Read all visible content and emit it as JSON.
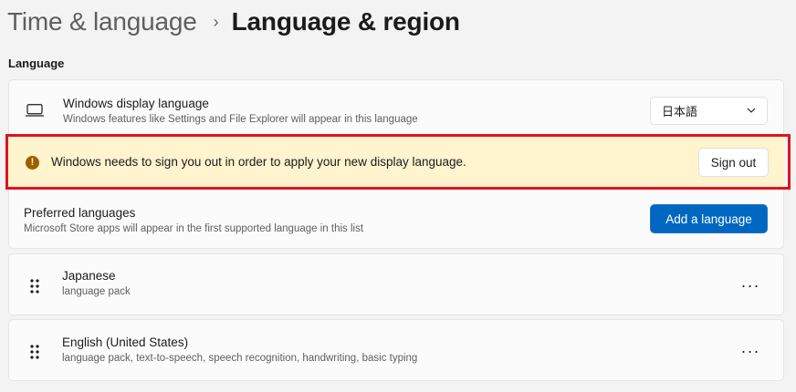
{
  "breadcrumb": {
    "parent": "Time & language",
    "separator": "›",
    "current": "Language & region"
  },
  "language_section": {
    "label": "Language",
    "display_language": {
      "icon": "monitor-icon",
      "title": "Windows display language",
      "subtitle": "Windows features like Settings and File Explorer will appear in this language",
      "selected": "日本語"
    },
    "warning": {
      "icon": "warning-icon",
      "icon_glyph": "!",
      "message": "Windows needs to sign you out in order to apply your new display language.",
      "button_label": "Sign out"
    },
    "preferred": {
      "title": "Preferred languages",
      "subtitle": "Microsoft Store apps will appear in the first supported language in this list",
      "add_button_label": "Add a language"
    },
    "languages": [
      {
        "name": "Japanese",
        "details": "language pack"
      },
      {
        "name": "English (United States)",
        "details": "language pack, text-to-speech, speech recognition, handwriting, basic typing"
      }
    ],
    "more_glyph": "···"
  },
  "colors": {
    "accent": "#0067c0",
    "warning_bg": "#fff4ce",
    "warning_icon": "#9d5d00",
    "highlight_border": "#e0141e"
  }
}
